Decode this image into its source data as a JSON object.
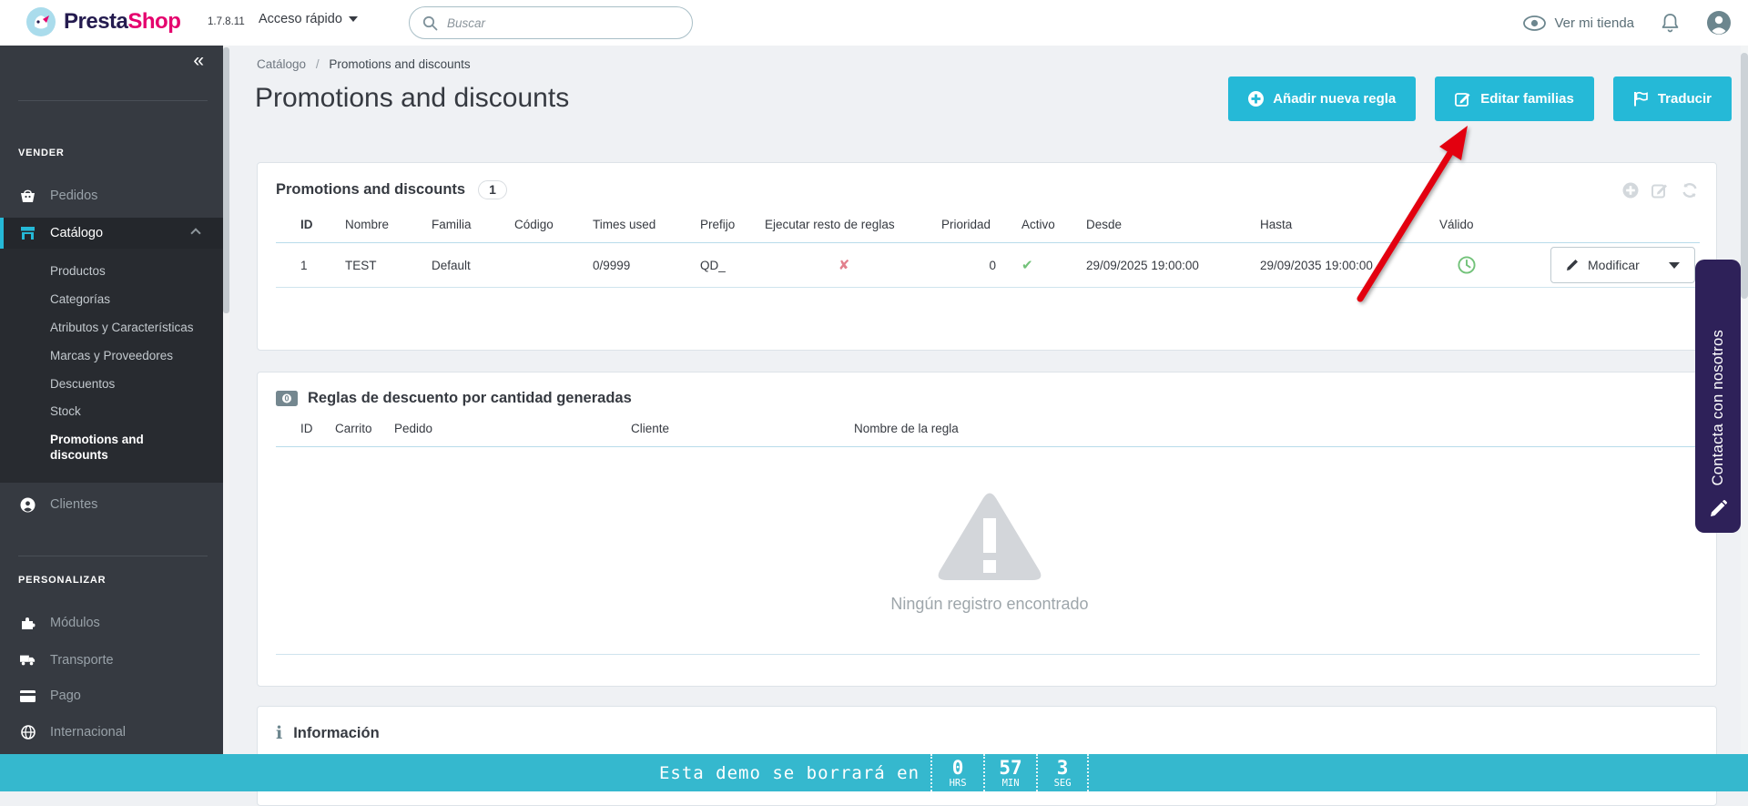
{
  "colors": {
    "accent": "#25b9d7",
    "sidebar_bg": "#363a41",
    "sidebar_active_bg": "#282b30",
    "success": "#72c279",
    "danger": "#e2808d",
    "arrow_annotation": "#e3000f",
    "contact_tab_bg": "#2e2159",
    "demo_bar_bg": "#35b8ce"
  },
  "icons": {
    "collapse_glyph": "«",
    "check_glyph": "✔",
    "cross_glyph": "✘",
    "breadcrumb_separator": "/"
  },
  "header": {
    "logo_presta": "Presta",
    "logo_shop": "Shop",
    "version": "1.7.8.11",
    "quick_access": "Acceso rápido",
    "search_placeholder": "Buscar",
    "view_shop": "Ver mi tienda"
  },
  "sidebar": {
    "section_sell": "VENDER",
    "section_customize": "PERSONALIZAR",
    "items": {
      "pedidos": "Pedidos",
      "catalogo": "Catálogo",
      "clientes": "Clientes",
      "modulos": "Módulos",
      "transporte": "Transporte",
      "pago": "Pago",
      "internacional": "Internacional"
    },
    "catalog_submenu": [
      "Productos",
      "Categorías",
      "Atributos y Características",
      "Marcas y Proveedores",
      "Descuentos",
      "Stock",
      "Promotions and discounts"
    ]
  },
  "breadcrumb": {
    "parent": "Catálogo",
    "current": "Promotions and discounts"
  },
  "page": {
    "title": "Promotions and discounts"
  },
  "toolbar": {
    "add_rule": "Añadir nueva regla",
    "edit_families": "Editar familias",
    "translate": "Traducir"
  },
  "panel1": {
    "title": "Promotions and discounts",
    "count": "1",
    "columns": [
      "ID",
      "Nombre",
      "Familia",
      "Código",
      "Times used",
      "Prefijo",
      "Ejecutar resto de reglas",
      "Prioridad",
      "Activo",
      "Desde",
      "Hasta",
      "Válido"
    ],
    "rows": [
      {
        "id": "1",
        "nombre": "TEST",
        "familia": "Default",
        "codigo": "",
        "times_used": "0/9999",
        "prefijo": "QD_",
        "ejecutar_resto": "no",
        "prioridad": "0",
        "activo": "sí",
        "desde": "29/09/2025 19:00:00",
        "hasta": "29/09/2035 19:00:00",
        "valido": "reloj",
        "action_label": "Modificar"
      }
    ]
  },
  "panel2": {
    "title": "Reglas de descuento por cantidad generadas",
    "columns": [
      "ID",
      "Carrito",
      "Pedido",
      "Cliente",
      "Nombre de la regla"
    ],
    "empty_message": "Ningún registro encontrado"
  },
  "panel3": {
    "title": "Información"
  },
  "demo_bar": {
    "message": "Esta demo se borrará en",
    "units": [
      {
        "value": "0",
        "label": "HRS"
      },
      {
        "value": "57",
        "label": "MIN"
      },
      {
        "value": "3",
        "label": "SEG"
      }
    ]
  },
  "contact_tab": {
    "label": "Contacta con nosotros"
  }
}
